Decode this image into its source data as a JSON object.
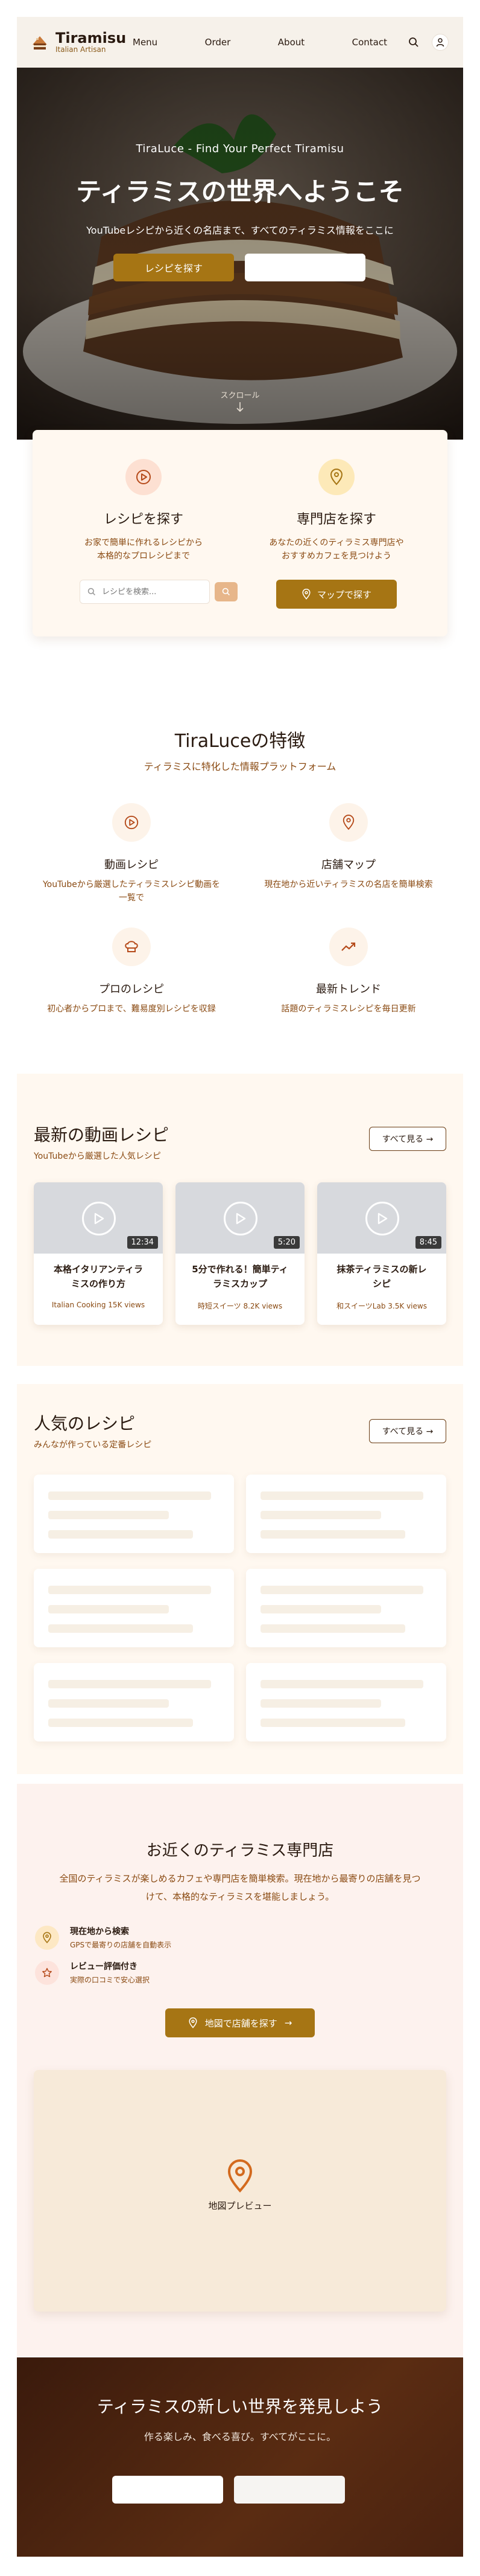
{
  "header": {
    "brand_title": "Tiramisu",
    "brand_subtitle": "Italian Artisan",
    "nav": [
      "Menu",
      "Order",
      "About",
      "Contact"
    ]
  },
  "hero": {
    "tagline": "TiraLuce - Find Your Perfect Tiramisu",
    "title": "ティラミスの世界へようこそ",
    "subtitle": "YouTubeレシピから近くの名店まで、すべてのティラミス情報をここに",
    "primary_button": "レシピを探す",
    "secondary_button": "",
    "scroll_label": "スクロール"
  },
  "search_card": {
    "recipe": {
      "title": "レシピを探す",
      "desc_line1": "お家で簡単に作れるレシピから",
      "desc_line2": "本格的なプロレシピまで",
      "search_placeholder": "レシピを検索..."
    },
    "shop": {
      "title": "専門店を探す",
      "desc_line1": "あなたの近くのティラミス専門店や",
      "desc_line2": "おすすめカフェを見つけよう",
      "button": "マップで探す"
    }
  },
  "features": {
    "title": "TiraLuceの特徴",
    "subtitle": "ティラミスに特化した情報プラットフォーム",
    "items": [
      {
        "name": "動画レシピ",
        "desc_line1": "YouTubeから厳選したティラミスレシピ動画を",
        "desc_line2": "一覧で",
        "icon": "play-icon"
      },
      {
        "name": "店舗マップ",
        "desc_line1": "現在地から近いティラミスの名店を簡単検索",
        "desc_line2": "",
        "icon": "map-pin-icon"
      },
      {
        "name": "プロのレシピ",
        "desc_line1": "初心者からプロまで、難易度別レシピを収録",
        "desc_line2": "",
        "icon": "chef-hat-icon"
      },
      {
        "name": "最新トレンド",
        "desc_line1": "話題のティラミスレシピを毎日更新",
        "desc_line2": "",
        "icon": "trending-icon"
      }
    ]
  },
  "videos": {
    "title": "最新の動画レシピ",
    "subtitle": "YouTubeから厳選した人気レシピ",
    "see_all": "すべて見る →",
    "items": [
      {
        "duration": "12:34",
        "title_line1": "本格イタリアンティラ",
        "title_line2": "ミスの作り方",
        "channel": "Italian Cooking",
        "views": "15K views"
      },
      {
        "duration": "5:20",
        "title_line1": "5分で作れる！簡単ティ",
        "title_line2": "ラミスカップ",
        "channel": "時短スイーツ",
        "views": "8.2K views"
      },
      {
        "duration": "8:45",
        "title_line1": "抹茶ティラミスの新レ",
        "title_line2": "シピ",
        "channel": "和スイーツLab",
        "views": "3.5K views"
      }
    ]
  },
  "popular": {
    "title": "人気のレシピ",
    "subtitle": "みんなが作っている定番レシピ",
    "see_all": "すべて見る →"
  },
  "shops": {
    "title": "お近くのティラミス専門店",
    "desc_line1": "全国のティラミスが楽しめるカフェや専門店を簡単検索。現在地から最寄りの店舗を見つ",
    "desc_line2": "けて、本格的なティラミスを堪能しましょう。",
    "features": [
      {
        "title": "現在地から検索",
        "desc": "GPSで最寄りの店舗を自動表示",
        "icon": "map-pin-icon"
      },
      {
        "title": "レビュー評価付き",
        "desc": "実際の口コミで安心選択",
        "icon": "star-icon"
      }
    ],
    "button": "地図で店舗を探す",
    "map_label": "地図プレビュー"
  },
  "cta": {
    "title": "ティラミスの新しい世界を発見しよう",
    "subtitle": "作る楽しみ、食べる喜び。すべてがここに。",
    "button1": "",
    "button2": ""
  },
  "colors": {
    "accent": "#a67514",
    "text_brown": "#8a4a12",
    "cream": "#fff8f0",
    "dark_cta": "#3a1a0c"
  }
}
